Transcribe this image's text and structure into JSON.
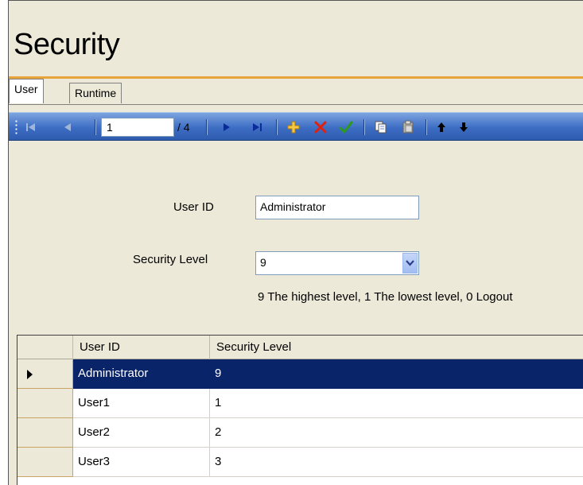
{
  "window": {
    "title": "Security"
  },
  "tabs": [
    {
      "label": "User",
      "active": true
    },
    {
      "label": "Runtime",
      "active": false
    }
  ],
  "toolbar": {
    "position": "1",
    "total": "/ 4",
    "buttons": [
      "move-first-icon",
      "move-previous-icon",
      "move-next-icon",
      "move-last-icon",
      "add-icon",
      "delete-icon",
      "save-icon",
      "copy-icon",
      "paste-icon",
      "move-up-icon",
      "move-down-icon"
    ]
  },
  "form": {
    "user_id_label": "User ID",
    "user_id_value": "Administrator",
    "security_level_label": "Security Level",
    "security_level_value": "9",
    "hint": "9 The highest level, 1 The lowest level, 0 Logout"
  },
  "grid": {
    "columns": [
      "User ID",
      "Security Level"
    ],
    "rows": [
      {
        "user_id": "Administrator",
        "level": "9",
        "selected": true
      },
      {
        "user_id": "User1",
        "level": "1",
        "selected": false
      },
      {
        "user_id": "User2",
        "level": "2",
        "selected": false
      },
      {
        "user_id": "User3",
        "level": "3",
        "selected": false
      }
    ]
  },
  "colors": {
    "accent": "#E8A33A",
    "toolbar": "#3D6DC4",
    "selection": "#0A246A",
    "background": "#ECE9D8"
  }
}
